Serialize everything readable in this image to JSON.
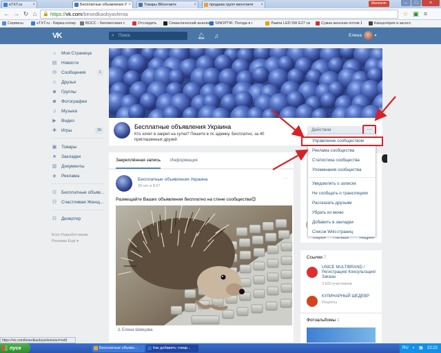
{
  "browser": {
    "tabs": [
      {
        "label": "eTXT.ru",
        "fav": "#3b7dd8"
      },
      {
        "label": "Бесплатные объявления У",
        "fav": "#4a76a8"
      },
      {
        "label": "Товары ВКонтакте",
        "fav": "#4a76a8"
      },
      {
        "label": "продажа групп вконтакте",
        "fav": "#e8a23a"
      }
    ],
    "user_badge": "Marsianin",
    "url_https": "https://",
    "url_host": "vk.com",
    "url_path": "/besedkaobyavlenia",
    "bookmarks": [
      {
        "label": "Сервисы",
        "fav": "#5a8ae0"
      },
      {
        "label": "eTXT.ru - Биржа копир",
        "fav": "#3b7dd8"
      },
      {
        "label": "ВОСС - биллинговая с",
        "fav": "#777"
      },
      {
        "label": "Отследить",
        "fav": "#d33"
      },
      {
        "label": "Семантический анализ",
        "fav": "#222"
      },
      {
        "label": "SINOPTIK: Погода в г",
        "fav": "#2c6fcc"
      },
      {
        "label": "Лампа LED 5W E27 св",
        "fav": "#e4a200"
      },
      {
        "label": "Сумка женская оптом 1",
        "fav": "#c33"
      },
      {
        "label": "Канцелярия и аксесс",
        "fav": "#444"
      }
    ]
  },
  "vk": {
    "logo": "VK",
    "search_placeholder": "Поиск",
    "user_name": "Елена"
  },
  "menu": [
    {
      "label": "Моя Страница",
      "icon": "home-icon",
      "glyph": "⌂",
      "count": ""
    },
    {
      "label": "Новости",
      "icon": "news-icon",
      "glyph": "▤",
      "count": ""
    },
    {
      "label": "Сообщения",
      "icon": "messages-icon",
      "glyph": "✉",
      "count": "1"
    },
    {
      "label": "Друзья",
      "icon": "friends-icon",
      "glyph": "☺",
      "count": ""
    },
    {
      "label": "Группы",
      "icon": "groups-icon",
      "glyph": "☻",
      "count": ""
    },
    {
      "label": "Фотографии",
      "icon": "photos-icon",
      "glyph": "◙",
      "count": ""
    },
    {
      "label": "Музыка",
      "icon": "music-icon",
      "glyph": "♫",
      "count": ""
    },
    {
      "label": "Видео",
      "icon": "video-icon",
      "glyph": "▶",
      "count": ""
    },
    {
      "label": "Игры",
      "icon": "games-icon",
      "glyph": "✚",
      "count": "39"
    },
    {
      "label": "Товары",
      "icon": "goods-icon",
      "glyph": "▣",
      "count": ""
    },
    {
      "label": "Закладки",
      "icon": "bookmarks-icon",
      "glyph": "★",
      "count": ""
    },
    {
      "label": "Документы",
      "icon": "documents-icon",
      "glyph": "▥",
      "count": ""
    },
    {
      "label": "Реклама",
      "icon": "ads-icon",
      "glyph": "◈",
      "count": ""
    },
    {
      "label": "Бесплатные объяв...",
      "icon": "community-icon",
      "glyph": "☷",
      "count": ""
    },
    {
      "label": "Счастливая Женщ...",
      "icon": "community-icon",
      "glyph": "☷",
      "count": ""
    },
    {
      "label": "Дезертир",
      "icon": "game-icon",
      "glyph": "☷",
      "count": ""
    }
  ],
  "footer": {
    "line1": "Блог  Разработчикам",
    "line2": "Реклама  Ещё ▾"
  },
  "group": {
    "name": "Бесплатные объявления Украина",
    "status": "Кто хочет в закреп на сутки? Пишите в лс админу. Бесплатно, за 40 приглашенных друзей",
    "actions_label": "Действия",
    "more_label": "···"
  },
  "dropdown": {
    "items": [
      "Управление сообществом",
      "Реклама сообщества",
      "Статистика сообщества",
      "Упоминания сообщества",
      "Уведомлять о записях",
      "Не сообщать о трансляциях",
      "Рассказать друзьям",
      "Убрать из меню",
      "Добавить в закладки",
      "Список Wiki-страниц"
    ]
  },
  "tabs": [
    "Закреплённая запись",
    "Информация"
  ],
  "post": {
    "author": "Бесплатные объявления Украина",
    "date": "30 окт в 8:07",
    "text": "Размещайте Ваших объявления бесплатно на стене сообщества😊",
    "signed": "Елена Шевцова",
    "more": "···"
  },
  "right": {
    "friends": [
      "Мария",
      "Наташа",
      "Андрей"
    ],
    "links_header": "Ссылки",
    "links_count": "7",
    "links": [
      {
        "title": "UNICE MULTIBRAND / Регистрация/ Консультация/Заказы",
        "sub": "3 620 участников",
        "color": "#e02d2d"
      },
      {
        "title": "КУЛИНАРНЫЙ ШЕДЕВР",
        "sub": "Рецепты",
        "color": "#d4441a"
      }
    ],
    "photos_header": "Фотоальбомы",
    "photos_count": "1"
  },
  "status_url": "https://vk.com/besedkaobyavlenia/act=edit",
  "taskbar": {
    "start": "пуск",
    "items": [
      {
        "label": "Бесплатные объявл...",
        "fav": "#e8a23a",
        "active": false
      },
      {
        "label": "Как добавить товар...",
        "fav": "#2c6fcc",
        "active": true
      }
    ],
    "lang": "RU",
    "time": "22:22"
  }
}
